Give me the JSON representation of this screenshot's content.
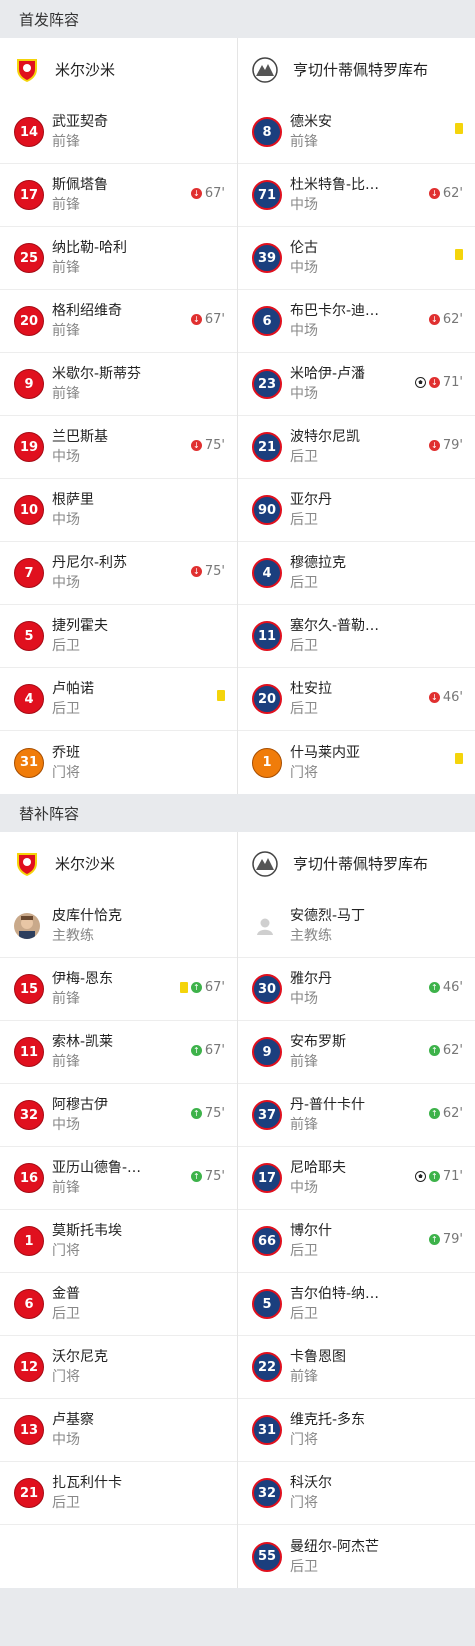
{
  "starting": {
    "title": "首发阵容",
    "home": {
      "team": "米尔沙米",
      "players": [
        {
          "num": "14",
          "name": "武亚契奇",
          "pos": "前锋",
          "events": []
        },
        {
          "num": "17",
          "name": "斯佩塔鲁",
          "pos": "前锋",
          "events": [
            {
              "type": "out",
              "min": "67'"
            }
          ]
        },
        {
          "num": "25",
          "name": "纳比勒-哈利",
          "pos": "前锋",
          "events": []
        },
        {
          "num": "20",
          "name": "格利绍维奇",
          "pos": "前锋",
          "events": [
            {
              "type": "out",
              "min": "67'"
            }
          ]
        },
        {
          "num": "9",
          "name": "米歇尔-斯蒂芬",
          "pos": "前锋",
          "events": []
        },
        {
          "num": "19",
          "name": "兰巴斯基",
          "pos": "中场",
          "events": [
            {
              "type": "out",
              "min": "75'"
            }
          ]
        },
        {
          "num": "10",
          "name": "根萨里",
          "pos": "中场",
          "events": []
        },
        {
          "num": "7",
          "name": "丹尼尔-利苏",
          "pos": "中场",
          "events": [
            {
              "type": "out",
              "min": "75'"
            }
          ]
        },
        {
          "num": "5",
          "name": "捷列霍夫",
          "pos": "后卫",
          "events": []
        },
        {
          "num": "4",
          "name": "卢帕诺",
          "pos": "后卫",
          "events": [
            {
              "type": "yellow"
            }
          ]
        },
        {
          "num": "31",
          "name": "乔班",
          "pos": "门将",
          "gk": true,
          "events": []
        }
      ]
    },
    "away": {
      "team": "亨切什蒂佩特罗库布",
      "players": [
        {
          "num": "8",
          "name": "德米安",
          "pos": "前锋",
          "events": [
            {
              "type": "yellow"
            }
          ]
        },
        {
          "num": "71",
          "name": "杜米特鲁-比…",
          "pos": "中场",
          "events": [
            {
              "type": "out",
              "min": "62'"
            }
          ]
        },
        {
          "num": "39",
          "name": "伦古",
          "pos": "中场",
          "events": [
            {
              "type": "yellow"
            }
          ]
        },
        {
          "num": "6",
          "name": "布巴卡尔-迪…",
          "pos": "中场",
          "events": [
            {
              "type": "out",
              "min": "62'"
            }
          ]
        },
        {
          "num": "23",
          "name": "米哈伊-卢潘",
          "pos": "中场",
          "events": [
            {
              "type": "goal"
            },
            {
              "type": "out",
              "min": "71'"
            }
          ]
        },
        {
          "num": "21",
          "name": "波特尔尼凯",
          "pos": "后卫",
          "events": [
            {
              "type": "out",
              "min": "79'"
            }
          ]
        },
        {
          "num": "90",
          "name": "亚尔丹",
          "pos": "后卫",
          "events": []
        },
        {
          "num": "4",
          "name": "穆德拉克",
          "pos": "后卫",
          "events": []
        },
        {
          "num": "11",
          "name": "塞尔久-普勒…",
          "pos": "后卫",
          "events": []
        },
        {
          "num": "20",
          "name": "杜安拉",
          "pos": "后卫",
          "events": [
            {
              "type": "out",
              "min": "46'"
            }
          ]
        },
        {
          "num": "1",
          "name": "什马莱内亚",
          "pos": "门将",
          "gk": true,
          "events": [
            {
              "type": "yellow"
            }
          ]
        }
      ]
    }
  },
  "subs": {
    "title": "替补阵容",
    "home": {
      "team": "米尔沙米",
      "coach": {
        "name": "皮库什恰克",
        "role": "主教练"
      },
      "players": [
        {
          "num": "15",
          "name": "伊梅-恩东",
          "pos": "前锋",
          "events": [
            {
              "type": "yellow"
            },
            {
              "type": "in",
              "min": "67'"
            }
          ]
        },
        {
          "num": "11",
          "name": "索林-凯莱",
          "pos": "前锋",
          "events": [
            {
              "type": "in",
              "min": "67'"
            }
          ]
        },
        {
          "num": "32",
          "name": "阿穆古伊",
          "pos": "中场",
          "events": [
            {
              "type": "in",
              "min": "75'"
            }
          ]
        },
        {
          "num": "16",
          "name": "亚历山德鲁-…",
          "pos": "前锋",
          "events": [
            {
              "type": "in",
              "min": "75'"
            }
          ]
        },
        {
          "num": "1",
          "name": "莫斯托韦埃",
          "pos": "门将",
          "events": []
        },
        {
          "num": "6",
          "name": "金普",
          "pos": "后卫",
          "events": []
        },
        {
          "num": "12",
          "name": "沃尔尼克",
          "pos": "门将",
          "events": []
        },
        {
          "num": "13",
          "name": "卢基察",
          "pos": "中场",
          "events": []
        },
        {
          "num": "21",
          "name": "扎瓦利什卡",
          "pos": "后卫",
          "events": []
        }
      ]
    },
    "away": {
      "team": "亨切什蒂佩特罗库布",
      "coach": {
        "name": "安德烈-马丁",
        "role": "主教练"
      },
      "players": [
        {
          "num": "30",
          "name": "雅尔丹",
          "pos": "中场",
          "events": [
            {
              "type": "in",
              "min": "46'"
            }
          ]
        },
        {
          "num": "9",
          "name": "安布罗斯",
          "pos": "前锋",
          "events": [
            {
              "type": "in",
              "min": "62'"
            }
          ]
        },
        {
          "num": "37",
          "name": "丹-普什卡什",
          "pos": "前锋",
          "events": [
            {
              "type": "in",
              "min": "62'"
            }
          ]
        },
        {
          "num": "17",
          "name": "尼哈耶夫",
          "pos": "中场",
          "events": [
            {
              "type": "goal"
            },
            {
              "type": "in",
              "min": "71'"
            }
          ]
        },
        {
          "num": "66",
          "name": "博尔什",
          "pos": "后卫",
          "events": [
            {
              "type": "in",
              "min": "79'"
            }
          ]
        },
        {
          "num": "5",
          "name": "吉尔伯特-纳…",
          "pos": "后卫",
          "events": []
        },
        {
          "num": "22",
          "name": "卡鲁恩图",
          "pos": "前锋",
          "events": []
        },
        {
          "num": "31",
          "name": "维克托-多东",
          "pos": "门将",
          "events": []
        },
        {
          "num": "32",
          "name": "科沃尔",
          "pos": "门将",
          "events": []
        },
        {
          "num": "55",
          "name": "曼纽尔-阿杰芒",
          "pos": "后卫",
          "events": []
        }
      ]
    }
  },
  "colors": {
    "home_badge": "#e0101e",
    "away_badge": "#1b3f7e",
    "gk_badge": "#f07c0a",
    "yellow_card": "#f4d40b",
    "sub_out": "#e03030",
    "sub_in": "#3db24a"
  },
  "icons": {
    "home_crest": "shield-crest-icon",
    "away_crest": "mountain-crest-icon",
    "yellow": "yellow-card-icon",
    "out": "sub-out-arrow-icon",
    "in": "sub-in-arrow-icon",
    "goal": "football-icon"
  }
}
